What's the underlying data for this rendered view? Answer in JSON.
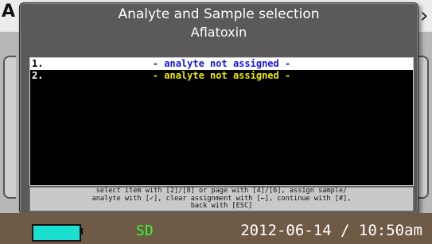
{
  "background": {
    "title_fragment": "A      Vi   Bl",
    "arrow_right": "›"
  },
  "dialog": {
    "title": "Analyte and Sample selection",
    "subtitle": "Aflatoxin"
  },
  "list": {
    "items": [
      {
        "number": "1.",
        "text": "- analyte not assigned -",
        "selected": true
      },
      {
        "number": "2.",
        "text": "- analyte not assigned -",
        "selected": false
      }
    ]
  },
  "help": {
    "line1": "select item with [2]/[8] or page with [4]/[6], assign sample/",
    "line2": "analyte with [✓], clear assignment with [←], continue with [#],",
    "line3": "back with [ESC]"
  },
  "status": {
    "storage": "SD",
    "datetime": "2012-06-14 / 10:50am",
    "battery_color": "#1ae0d0"
  }
}
